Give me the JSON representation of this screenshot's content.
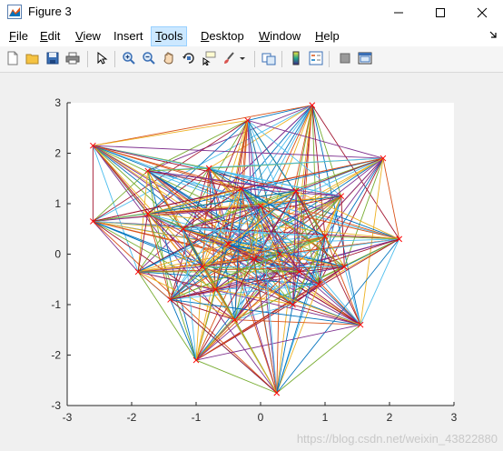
{
  "window": {
    "title": "Figure 3"
  },
  "menu": {
    "items": [
      {
        "id": "file",
        "ul": "F",
        "rest": "ile"
      },
      {
        "id": "edit",
        "ul": "E",
        "rest": "dit"
      },
      {
        "id": "view",
        "ul": "V",
        "rest": "iew"
      },
      {
        "id": "insert",
        "ul": "",
        "rest": "Insert"
      },
      {
        "id": "tools",
        "ul": "T",
        "rest": "ools"
      },
      {
        "id": "desktop",
        "ul": "D",
        "rest": "esktop"
      },
      {
        "id": "window",
        "ul": "W",
        "rest": "indow"
      },
      {
        "id": "help",
        "ul": "H",
        "rest": "elp"
      }
    ]
  },
  "toolbar": {
    "buttons": [
      "new-figure-icon",
      "open-file-icon",
      "save-icon",
      "print-icon",
      "pointer-icon",
      "zoom-in-icon",
      "zoom-out-icon",
      "pan-hand-icon",
      "rotate-3d-icon",
      "data-cursor-icon",
      "brush-icon",
      "link-plot-icon",
      "colorbar-icon",
      "legend-icon",
      "hide-plot-tools-icon",
      "show-plot-tools-icon"
    ]
  },
  "colors": {
    "series": [
      "#0072bd",
      "#d95319",
      "#edb120",
      "#7e2f8e",
      "#77ac30",
      "#4dbeee",
      "#a2142f"
    ],
    "marker": "#ff0000"
  },
  "chart_data": {
    "type": "line",
    "title": "",
    "xlabel": "",
    "ylabel": "",
    "xlim": [
      -3,
      3
    ],
    "ylim": [
      -3,
      3
    ],
    "xticks": [
      "-3",
      "-2",
      "-1",
      "0",
      "1",
      "2",
      "3"
    ],
    "yticks": [
      "-3",
      "-2",
      "-1",
      "0",
      "1",
      "2",
      "3"
    ],
    "grid": false,
    "marker": "x",
    "nodes": [
      [
        0.8,
        2.95
      ],
      [
        -0.2,
        2.65
      ],
      [
        -2.6,
        2.15
      ],
      [
        1.9,
        1.9
      ],
      [
        -0.8,
        1.7
      ],
      [
        -1.75,
        1.65
      ],
      [
        1.25,
        1.15
      ],
      [
        -2.6,
        0.65
      ],
      [
        -1.75,
        0.8
      ],
      [
        2.15,
        0.3
      ],
      [
        -0.5,
        0.2
      ],
      [
        0.3,
        0.0
      ],
      [
        -0.1,
        -0.1
      ],
      [
        1.3,
        -0.25
      ],
      [
        -1.9,
        -0.35
      ],
      [
        0.9,
        -0.6
      ],
      [
        -0.7,
        -0.7
      ],
      [
        0.5,
        -1.0
      ],
      [
        -0.4,
        -1.3
      ],
      [
        1.55,
        -1.4
      ],
      [
        -1.0,
        -2.1
      ],
      [
        0.25,
        -2.75
      ],
      [
        -1.2,
        0.5
      ],
      [
        0.0,
        0.95
      ],
      [
        0.55,
        1.25
      ],
      [
        -1.4,
        -0.9
      ],
      [
        1.0,
        0.35
      ],
      [
        -0.3,
        1.3
      ],
      [
        -0.9,
        -0.25
      ],
      [
        0.6,
        -0.35
      ]
    ]
  },
  "watermark": "https://blog.csdn.net/weixin_43822880"
}
